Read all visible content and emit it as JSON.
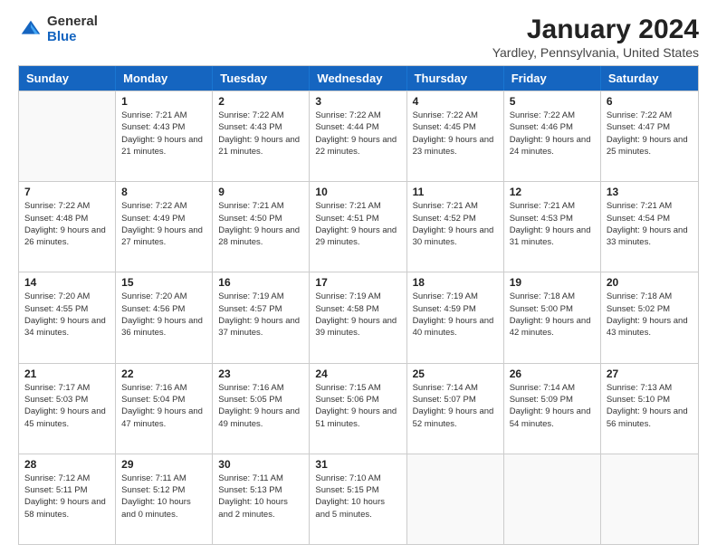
{
  "logo": {
    "general": "General",
    "blue": "Blue"
  },
  "title": "January 2024",
  "subtitle": "Yardley, Pennsylvania, United States",
  "header_days": [
    "Sunday",
    "Monday",
    "Tuesday",
    "Wednesday",
    "Thursday",
    "Friday",
    "Saturday"
  ],
  "weeks": [
    [
      {
        "day": "",
        "sunrise": "",
        "sunset": "",
        "daylight": ""
      },
      {
        "day": "1",
        "sunrise": "Sunrise: 7:21 AM",
        "sunset": "Sunset: 4:43 PM",
        "daylight": "Daylight: 9 hours and 21 minutes."
      },
      {
        "day": "2",
        "sunrise": "Sunrise: 7:22 AM",
        "sunset": "Sunset: 4:43 PM",
        "daylight": "Daylight: 9 hours and 21 minutes."
      },
      {
        "day": "3",
        "sunrise": "Sunrise: 7:22 AM",
        "sunset": "Sunset: 4:44 PM",
        "daylight": "Daylight: 9 hours and 22 minutes."
      },
      {
        "day": "4",
        "sunrise": "Sunrise: 7:22 AM",
        "sunset": "Sunset: 4:45 PM",
        "daylight": "Daylight: 9 hours and 23 minutes."
      },
      {
        "day": "5",
        "sunrise": "Sunrise: 7:22 AM",
        "sunset": "Sunset: 4:46 PM",
        "daylight": "Daylight: 9 hours and 24 minutes."
      },
      {
        "day": "6",
        "sunrise": "Sunrise: 7:22 AM",
        "sunset": "Sunset: 4:47 PM",
        "daylight": "Daylight: 9 hours and 25 minutes."
      }
    ],
    [
      {
        "day": "7",
        "sunrise": "Sunrise: 7:22 AM",
        "sunset": "Sunset: 4:48 PM",
        "daylight": "Daylight: 9 hours and 26 minutes."
      },
      {
        "day": "8",
        "sunrise": "Sunrise: 7:22 AM",
        "sunset": "Sunset: 4:49 PM",
        "daylight": "Daylight: 9 hours and 27 minutes."
      },
      {
        "day": "9",
        "sunrise": "Sunrise: 7:21 AM",
        "sunset": "Sunset: 4:50 PM",
        "daylight": "Daylight: 9 hours and 28 minutes."
      },
      {
        "day": "10",
        "sunrise": "Sunrise: 7:21 AM",
        "sunset": "Sunset: 4:51 PM",
        "daylight": "Daylight: 9 hours and 29 minutes."
      },
      {
        "day": "11",
        "sunrise": "Sunrise: 7:21 AM",
        "sunset": "Sunset: 4:52 PM",
        "daylight": "Daylight: 9 hours and 30 minutes."
      },
      {
        "day": "12",
        "sunrise": "Sunrise: 7:21 AM",
        "sunset": "Sunset: 4:53 PM",
        "daylight": "Daylight: 9 hours and 31 minutes."
      },
      {
        "day": "13",
        "sunrise": "Sunrise: 7:21 AM",
        "sunset": "Sunset: 4:54 PM",
        "daylight": "Daylight: 9 hours and 33 minutes."
      }
    ],
    [
      {
        "day": "14",
        "sunrise": "Sunrise: 7:20 AM",
        "sunset": "Sunset: 4:55 PM",
        "daylight": "Daylight: 9 hours and 34 minutes."
      },
      {
        "day": "15",
        "sunrise": "Sunrise: 7:20 AM",
        "sunset": "Sunset: 4:56 PM",
        "daylight": "Daylight: 9 hours and 36 minutes."
      },
      {
        "day": "16",
        "sunrise": "Sunrise: 7:19 AM",
        "sunset": "Sunset: 4:57 PM",
        "daylight": "Daylight: 9 hours and 37 minutes."
      },
      {
        "day": "17",
        "sunrise": "Sunrise: 7:19 AM",
        "sunset": "Sunset: 4:58 PM",
        "daylight": "Daylight: 9 hours and 39 minutes."
      },
      {
        "day": "18",
        "sunrise": "Sunrise: 7:19 AM",
        "sunset": "Sunset: 4:59 PM",
        "daylight": "Daylight: 9 hours and 40 minutes."
      },
      {
        "day": "19",
        "sunrise": "Sunrise: 7:18 AM",
        "sunset": "Sunset: 5:00 PM",
        "daylight": "Daylight: 9 hours and 42 minutes."
      },
      {
        "day": "20",
        "sunrise": "Sunrise: 7:18 AM",
        "sunset": "Sunset: 5:02 PM",
        "daylight": "Daylight: 9 hours and 43 minutes."
      }
    ],
    [
      {
        "day": "21",
        "sunrise": "Sunrise: 7:17 AM",
        "sunset": "Sunset: 5:03 PM",
        "daylight": "Daylight: 9 hours and 45 minutes."
      },
      {
        "day": "22",
        "sunrise": "Sunrise: 7:16 AM",
        "sunset": "Sunset: 5:04 PM",
        "daylight": "Daylight: 9 hours and 47 minutes."
      },
      {
        "day": "23",
        "sunrise": "Sunrise: 7:16 AM",
        "sunset": "Sunset: 5:05 PM",
        "daylight": "Daylight: 9 hours and 49 minutes."
      },
      {
        "day": "24",
        "sunrise": "Sunrise: 7:15 AM",
        "sunset": "Sunset: 5:06 PM",
        "daylight": "Daylight: 9 hours and 51 minutes."
      },
      {
        "day": "25",
        "sunrise": "Sunrise: 7:14 AM",
        "sunset": "Sunset: 5:07 PM",
        "daylight": "Daylight: 9 hours and 52 minutes."
      },
      {
        "day": "26",
        "sunrise": "Sunrise: 7:14 AM",
        "sunset": "Sunset: 5:09 PM",
        "daylight": "Daylight: 9 hours and 54 minutes."
      },
      {
        "day": "27",
        "sunrise": "Sunrise: 7:13 AM",
        "sunset": "Sunset: 5:10 PM",
        "daylight": "Daylight: 9 hours and 56 minutes."
      }
    ],
    [
      {
        "day": "28",
        "sunrise": "Sunrise: 7:12 AM",
        "sunset": "Sunset: 5:11 PM",
        "daylight": "Daylight: 9 hours and 58 minutes."
      },
      {
        "day": "29",
        "sunrise": "Sunrise: 7:11 AM",
        "sunset": "Sunset: 5:12 PM",
        "daylight": "Daylight: 10 hours and 0 minutes."
      },
      {
        "day": "30",
        "sunrise": "Sunrise: 7:11 AM",
        "sunset": "Sunset: 5:13 PM",
        "daylight": "Daylight: 10 hours and 2 minutes."
      },
      {
        "day": "31",
        "sunrise": "Sunrise: 7:10 AM",
        "sunset": "Sunset: 5:15 PM",
        "daylight": "Daylight: 10 hours and 5 minutes."
      },
      {
        "day": "",
        "sunrise": "",
        "sunset": "",
        "daylight": ""
      },
      {
        "day": "",
        "sunrise": "",
        "sunset": "",
        "daylight": ""
      },
      {
        "day": "",
        "sunrise": "",
        "sunset": "",
        "daylight": ""
      }
    ]
  ]
}
